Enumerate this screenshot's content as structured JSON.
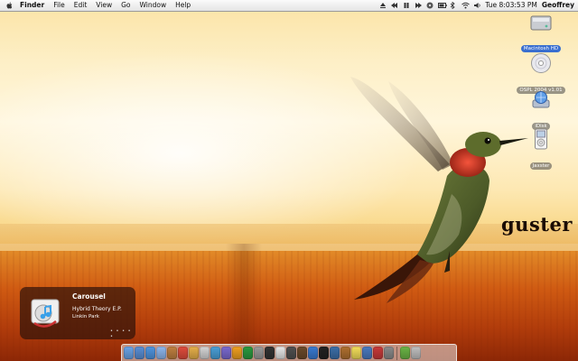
{
  "menubar": {
    "app_name": "Finder",
    "menus": [
      "File",
      "Edit",
      "View",
      "Go",
      "Window",
      "Help"
    ],
    "clock": "Tue 8:03:53 PM",
    "user": "Geoffrey"
  },
  "desktop_icons": [
    {
      "label": "Macintosh HD",
      "icon": "hard-drive-icon",
      "selected": true
    },
    {
      "label": "OSPL 2004 v1.01",
      "icon": "cd-disc-icon",
      "selected": false
    },
    {
      "label": "iDisk",
      "icon": "idisk-icon",
      "selected": false
    },
    {
      "label": "Jaxster",
      "icon": "ipod-icon",
      "selected": false
    }
  ],
  "wallpaper": {
    "caption": "guster"
  },
  "notification": {
    "song": "Carousel",
    "album": "Hybrid Theory E.P.",
    "artist": "Linkin Park",
    "rating": "• • • • •"
  },
  "dock": {
    "items": [
      {
        "name": "finder-dock-icon",
        "color": "#6aa4e8"
      },
      {
        "name": "mail-dock-icon",
        "color": "#5a8fd6"
      },
      {
        "name": "safari-dock-icon",
        "color": "#4f95e0"
      },
      {
        "name": "ichat-dock-icon",
        "color": "#8db7ee"
      },
      {
        "name": "address-book-dock-icon",
        "color": "#c08040"
      },
      {
        "name": "ical-dock-icon",
        "color": "#e04c3c"
      },
      {
        "name": "preview-dock-icon",
        "color": "#e7b04a"
      },
      {
        "name": "itunes-dock-icon",
        "color": "#d5d5d5"
      },
      {
        "name": "iphoto-dock-icon",
        "color": "#4aa0d8"
      },
      {
        "name": "imovie-dock-icon",
        "color": "#7a6ad0"
      },
      {
        "name": "garageband-dock-icon",
        "color": "#f0a020"
      },
      {
        "name": "network-dock-icon",
        "color": "#2a9a40"
      },
      {
        "name": "system-prefs-dock-icon",
        "color": "#9a9a9a"
      },
      {
        "name": "terminal-dock-icon",
        "color": "#333333"
      },
      {
        "name": "textedit-dock-icon",
        "color": "#e8e8e8"
      },
      {
        "name": "calculator-dock-icon",
        "color": "#505050"
      },
      {
        "name": "dictionary-dock-icon",
        "color": "#6b4a2a"
      },
      {
        "name": "quicktime-dock-icon",
        "color": "#3a7ad0"
      },
      {
        "name": "dvd-player-dock-icon",
        "color": "#222222"
      },
      {
        "name": "image-capture-dock-icon",
        "color": "#3c6fa8"
      },
      {
        "name": "sherlock-dock-icon",
        "color": "#b07030"
      },
      {
        "name": "stickies-dock-icon",
        "color": "#f4df5a"
      },
      {
        "name": "internet-connect-dock-icon",
        "color": "#4a7ac0"
      },
      {
        "name": "font-book-dock-icon",
        "color": "#c93a3a"
      },
      {
        "name": "chess-dock-icon",
        "color": "#8a8a8a"
      }
    ],
    "trailing_items": [
      {
        "name": "downloads-dock-icon",
        "color": "#6bb546"
      },
      {
        "name": "trash-dock-icon",
        "color": "#c0c0c0"
      }
    ]
  }
}
